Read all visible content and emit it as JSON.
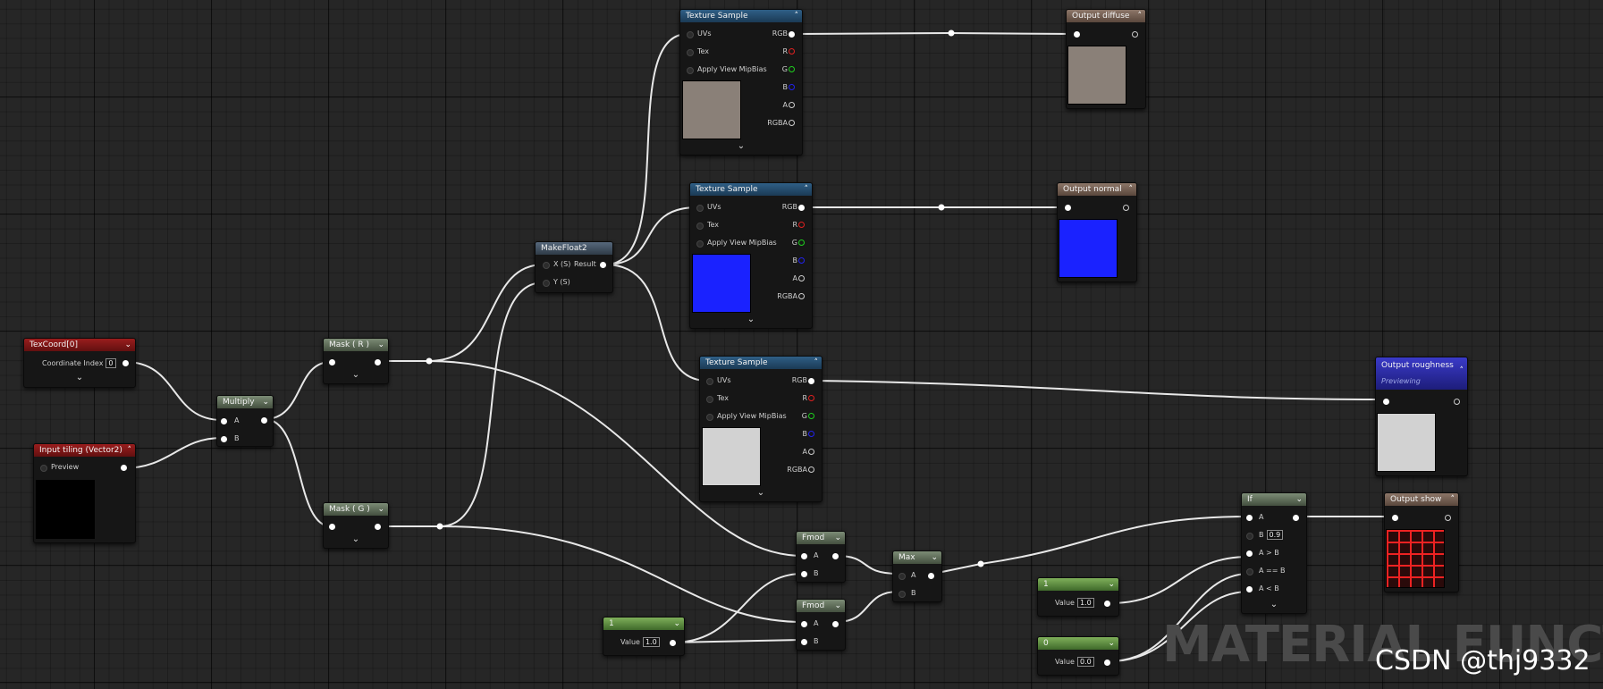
{
  "colors": {
    "wire": "#ffffff",
    "background": "#262626",
    "diffuse_preview": "#8a8078",
    "normal_preview": "#1a22ff",
    "roughness_preview": "#d2d2d2",
    "tiling_preview": "#000000",
    "grid_line": "#e02222"
  },
  "nodes": {
    "texcoord": {
      "title": "TexCoord[0]",
      "label": "Coordinate Index",
      "value": "0"
    },
    "tiling": {
      "title": "Input tiling (Vector2)",
      "label": "Preview"
    },
    "multiply": {
      "title": "Multiply",
      "a": "A",
      "b": "B"
    },
    "mask_r": {
      "title": "Mask ( R )"
    },
    "mask_g": {
      "title": "Mask ( G )"
    },
    "makefloat2": {
      "title": "MakeFloat2",
      "x": "X (S)",
      "y": "Y (S)",
      "result": "Result"
    },
    "tex1": {
      "title": "Texture Sample",
      "uvs": "UVs",
      "tex": "Tex",
      "mip": "Apply View MipBias",
      "rgb": "RGB",
      "r": "R",
      "g": "G",
      "b": "B",
      "a": "A",
      "rgba": "RGBA"
    },
    "tex2": {
      "title": "Texture Sample",
      "uvs": "UVs",
      "tex": "Tex",
      "mip": "Apply View MipBias",
      "rgb": "RGB",
      "r": "R",
      "g": "G",
      "b": "B",
      "a": "A",
      "rgba": "RGBA"
    },
    "tex3": {
      "title": "Texture Sample",
      "uvs": "UVs",
      "tex": "Tex",
      "mip": "Apply View MipBias",
      "rgb": "RGB",
      "r": "R",
      "g": "G",
      "b": "B",
      "a": "A",
      "rgba": "RGBA"
    },
    "out_diffuse": {
      "title": "Output diffuse"
    },
    "out_normal": {
      "title": "Output normal"
    },
    "out_rough": {
      "title": "Output roughness",
      "sub": "Previewing"
    },
    "out_show": {
      "title": "Output show"
    },
    "fmod1": {
      "title": "Fmod",
      "a": "A",
      "b": "B"
    },
    "fmod2": {
      "title": "Fmod",
      "a": "A",
      "b": "B"
    },
    "max": {
      "title": "Max",
      "a": "A",
      "b": "B"
    },
    "const1": {
      "title": "1",
      "label": "Value",
      "value": "1.0"
    },
    "const_if1": {
      "title": "1",
      "label": "Value",
      "value": "1.0"
    },
    "const_if0": {
      "title": "0",
      "label": "Value",
      "value": "0.0"
    },
    "if": {
      "title": "If",
      "a": "A",
      "b": "B",
      "b_value": "0.9",
      "agb": "A > B",
      "aeb": "A == B",
      "alb": "A < B"
    }
  },
  "watermark": "MATERIAL FUNCTIO",
  "credit": "CSDN @thj9332"
}
